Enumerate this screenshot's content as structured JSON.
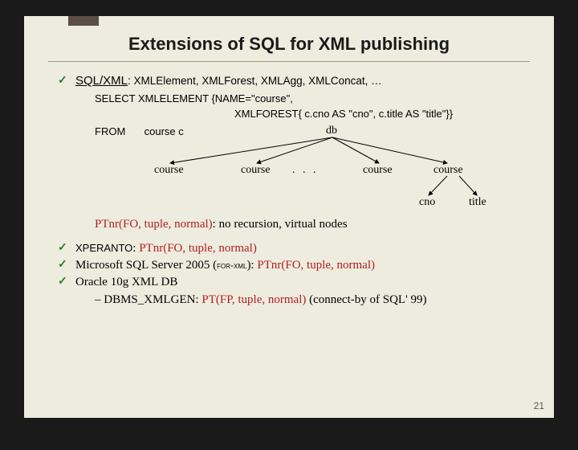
{
  "title": "Extensions of SQL for XML publishing",
  "bullet1_label": "SQL/XML",
  "bullet1_rest": ": XMLElement, XMLForest, XMLAgg, XMLConcat, …",
  "select_line": "SELECT XMLELEMENT {NAME=\"course\",",
  "forest_line": "XMLFOREST{ c.cno AS \"cno\", c.title AS \"title\"}}",
  "from_kw": "FROM",
  "from_rest": "course c",
  "tree": {
    "root": "db",
    "child": "course",
    "dots": ". . .",
    "leaf1": "cno",
    "leaf2": "title"
  },
  "ptnr_label": "PTnr",
  "ptnr_args": "(FO, tuple, normal)",
  "ptnr_desc": ": no recursion, virtual nodes",
  "xperanto_label": "XPERANTO",
  "xperanto_rest_a": ": ",
  "xperanto_ptnr": "PTnr",
  "xperanto_args": "(FO, tuple, normal)",
  "mssql_a": "Microsoft SQL Server 2005 (",
  "mssql_sc": "for-xml",
  "mssql_b": "): ",
  "mssql_ptnr": "PTnr",
  "mssql_args": "(FO, tuple, normal)",
  "oracle": "Oracle 10g XML DB",
  "dbms_a": "– DBMS_XMLGEN: ",
  "dbms_pt": "PT",
  "dbms_args": "(FP, tuple, normal)",
  "dbms_b": " (connect-by of SQL' 99)",
  "slidenum": "21",
  "check": "✓"
}
